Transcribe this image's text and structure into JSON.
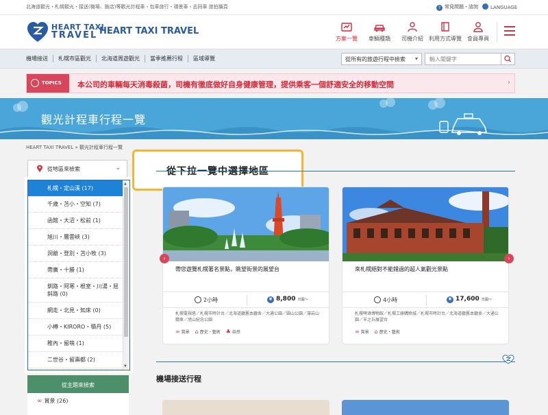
{
  "utility_bar": {
    "tagline": "北海道觀光・札幌觀光・接送(機場、飯店)等觀光計程車・包車旅行・環景車・志同車 旅拍攝頁",
    "faq": "常見問題・諮詢",
    "language": "LANGUAGE"
  },
  "header": {
    "logo_line1": "HEART TAXI",
    "logo_line2": "TRAVEL",
    "brand_title": "HEART TAXI TRAVEL",
    "nav": [
      {
        "label": "方案一覽",
        "icon": "route-plan-icon"
      },
      {
        "label": "車輛種類",
        "icon": "car-icon"
      },
      {
        "label": "司機介紹",
        "icon": "driver-icon"
      },
      {
        "label": "利用方式導覽",
        "icon": "guide-book-icon"
      },
      {
        "label": "會員專頁",
        "icon": "member-icon"
      }
    ]
  },
  "menu": {
    "items": [
      "機場接送",
      "札幌市區觀光",
      "北海道周遊觀光",
      "當季推薦行程",
      "區域導覽"
    ],
    "search_select": "從所有的旅遊行程中檢索",
    "search_placeholder": "輸入關鍵字"
  },
  "topics": {
    "badge": "TOPICS",
    "text": "本公司的車輛每天消毒殺菌，司機有徹底做好自身健康管理，提供乘客一個舒適安全的移動空間"
  },
  "banner": {
    "title": "觀光計程車行程一覽"
  },
  "breadcrumb": "HEART TAXI TRAVEL » 觀光計程車行程一覽",
  "region_select": {
    "label": "從地區來檢索"
  },
  "region_options": [
    "札幌・定山溪 (17)",
    "千歲・苫小・空知 (7)",
    "函館・大沼・松前 (1)",
    "旭川・層雲峽 (3)",
    "洞爺・登別・苫小牧 (3)",
    "帶廣・十勝 (1)",
    "釧路・阿寒・根室・川湯・屈斜路 (0)",
    "網走・北見・知床 (0)",
    "小樽・KIRORO・積丹 (5)",
    "稚內・留萌 (1)",
    "二世谷・留壽都 (2)"
  ],
  "callout": "從下拉一覽中選擇地區",
  "left_panel": {
    "header": "從主題來檢索",
    "row": "賞景 (26)"
  },
  "cards": [
    {
      "title": "帶您遊覽札幌著名景點，眺望街景的展望台",
      "duration": "2小時",
      "price": "8,800",
      "unit": "日圓～",
      "stops": "札幌電視塔／札幌市時計台／北海道廳舊本廳舍／大通公園／圓山公園／藻岩山纜車／旭山紀念公園",
      "tags": [
        "賞景",
        "歷史・藝術",
        "自然"
      ]
    },
    {
      "title": "來札幌絕對不能錯過的超人氣觀光景點",
      "duration": "4小時",
      "price": "17,600",
      "unit": "日圓～",
      "stops": "札幌啤酒博物館／札幌工廠購物城／札幌市時計台／北海道廳舊本廳舍／大通公園／羊之丘展望台",
      "tags": [
        "賞景",
        "歷史・藝術"
      ]
    }
  ],
  "airport_section": {
    "title": "機場接送行程"
  },
  "colors": {
    "accent_red": "#d02a3a",
    "brand_blue": "#2a5aa0",
    "banner_blue": "#4aa6d9",
    "callout_border": "#f2b534",
    "selected_blue": "#1e82d6",
    "green": "#4c8f6a"
  }
}
